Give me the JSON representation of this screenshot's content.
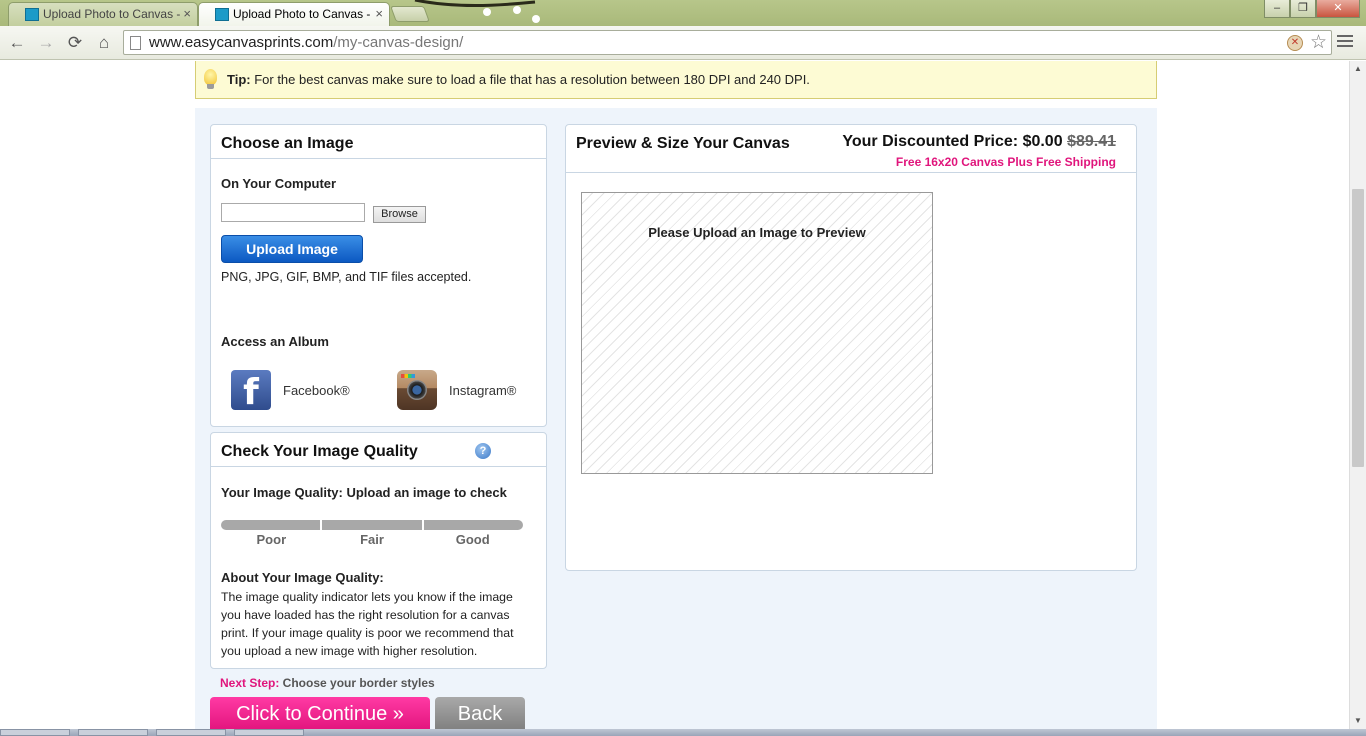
{
  "browser": {
    "tabs": [
      {
        "title": "Upload Photo to Canvas -",
        "close": "×",
        "active": false
      },
      {
        "title": "Upload Photo to Canvas -",
        "close": "×",
        "active": true
      }
    ],
    "url_domain": "www.easycanvasprints.com",
    "url_path": "/my-canvas-design/",
    "nav": {
      "back": "←",
      "forward": "→",
      "reload": "⟳",
      "home": "⌂"
    },
    "star": "☆",
    "window_controls": {
      "minimize": "–",
      "restore": "❐",
      "close": "✕"
    }
  },
  "tip": {
    "label": "Tip:",
    "text": " For the best canvas make sure to load a file that has a resolution between 180 DPI and 240 DPI."
  },
  "choose_image": {
    "title": "Choose an Image",
    "on_computer": "On Your Computer",
    "browse_label": "Browse",
    "upload_label": "Upload Image",
    "accepted_text": "PNG, JPG, GIF, BMP, and TIF files accepted.",
    "album_title": "Access an Album",
    "albums": [
      {
        "label": "Facebook®",
        "icon": "facebook-icon"
      },
      {
        "label": "Instagram®",
        "icon": "instagram-icon"
      }
    ]
  },
  "quality": {
    "title": "Check Your Image Quality",
    "help": "?",
    "status": "Your Image Quality: Upload an image to check",
    "levels": [
      "Poor",
      "Fair",
      "Good"
    ],
    "about_title": "About Your Image Quality:",
    "about_text": "The image quality indicator lets you know if the image you have loaded has the right resolution for a canvas print. If your image quality is poor we recommend that you upload a new image with higher resolution."
  },
  "next_step": {
    "label": "Next Step:",
    "text": " Choose your border styles",
    "continue_label": "Click to Continue »",
    "back_label": "Back"
  },
  "preview": {
    "title": "Preview & Size Your Canvas",
    "price_label": "Your Discounted Price: ",
    "price": "$0.00",
    "original_price": "$89.41",
    "free_note": "Free 16x20 Canvas Plus Free Shipping",
    "placeholder": "Please Upload an Image to Preview"
  },
  "colors": {
    "accent_pink": "#e0157c",
    "upload_blue": "#0c59c2",
    "content_bg": "#eef4fb",
    "tip_bg": "#fdfbd4"
  }
}
